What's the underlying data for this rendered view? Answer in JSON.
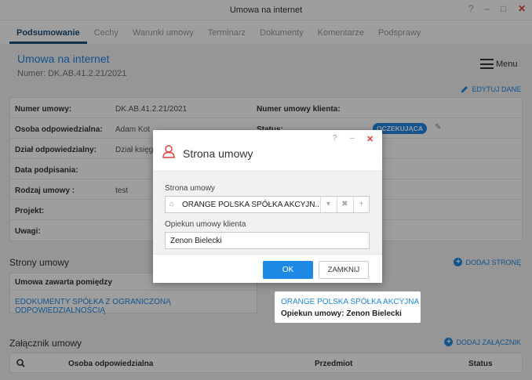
{
  "window": {
    "title": "Umowa na internet",
    "help": "?",
    "minimize": "–",
    "maximize": "□",
    "close": "✕"
  },
  "tabs": [
    {
      "label": "Podsumowanie",
      "active": true
    },
    {
      "label": "Cechy"
    },
    {
      "label": "Warunki umowy"
    },
    {
      "label": "Terminarz"
    },
    {
      "label": "Dokumenty"
    },
    {
      "label": "Komentarze"
    },
    {
      "label": "Podsprawy"
    }
  ],
  "header": {
    "title": "Umowa na internet",
    "number": "Numer: DK.AB.41.2.21/2021",
    "menu_label": "Menu",
    "edit_label": "EDYTUJ DANE"
  },
  "details": {
    "contract_number_label": "Numer umowy:",
    "contract_number": "DK.AB.41.2.21/2021",
    "client_number_label": "Numer umowy klienta:",
    "person_label": "Osoba odpowiedzialna:",
    "person": "Adam Kot",
    "status_label": "Status:",
    "status": "OCZEKUJĄCA",
    "dept_label": "Dział odpowiedzialny:",
    "dept": "Dział księgo",
    "signed_label": "Data podpisania:",
    "type_label": "Rodzaj umowy :",
    "type": "test",
    "project_label": "Projekt:",
    "notes_label": "Uwagi:"
  },
  "parties": {
    "title": "Strony umowy",
    "add_label": "DODAJ STRONĘ",
    "between_label": "Umowa zawarta pomiędzy",
    "left_party": "EDOKUMENTY SPÓŁKA Z OGRANICZONĄ ODPOWIEDZIALNOŚCIĄ",
    "right_party": "ORANGE POLSKA SPÓŁKA AKCYJNA",
    "right_guardian": "Opiekun umowy: Zenon Bielecki"
  },
  "attachments": {
    "title": "Załącznik umowy",
    "add_label": "DODAJ ZAŁĄCZNIK",
    "columns": [
      "Osoba odpowiedzialna",
      "Przedmiot",
      "Status"
    ]
  },
  "modal": {
    "title": "Strona umowy",
    "help": "?",
    "minimize": "–",
    "close": "✕",
    "party_label": "Strona umowy",
    "party_value": "ORANGE POLSKA SPÓŁKA AKCYJN...",
    "guardian_label": "Opiekun umowy klienta",
    "guardian_value": "Zenon Bielecki",
    "ok_label": "OK",
    "close_label": "ZAMKNIJ"
  },
  "colors": {
    "accent": "#1e88e5",
    "tab_active": "#1b4f7a",
    "close": "#e53935"
  }
}
